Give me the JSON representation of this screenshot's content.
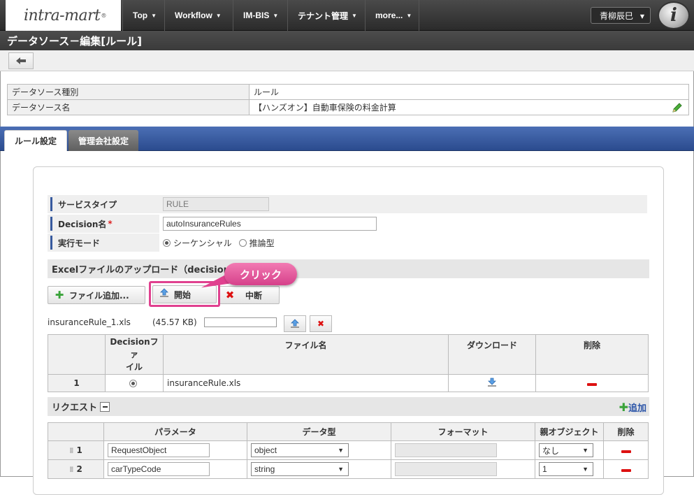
{
  "nav": {
    "logo": "intra-mart",
    "logo_mark": "®",
    "items": [
      "Top",
      "Workflow",
      "IM-BIS",
      "テナント管理",
      "more..."
    ],
    "user": "青柳辰巳"
  },
  "page": {
    "title": "データソース－編集[ルール]"
  },
  "info": {
    "rows": [
      {
        "label": "データソース種別",
        "value": "ルール"
      },
      {
        "label": "データソース名",
        "value": "【ハンズオン】自動車保険の料金計算"
      }
    ]
  },
  "tabs": [
    "ルール設定",
    "管理会社設定"
  ],
  "form": {
    "service_type_label": "サービスタイプ",
    "service_type_value": "RULE",
    "decision_label": "Decision名",
    "required_mark": "*",
    "decision_value": "autoInsuranceRules",
    "mode_label": "実行モード",
    "mode_options": [
      "シーケンシャル",
      "推論型"
    ]
  },
  "upload": {
    "section_title": "Excelファイルのアップロード（decisionファ",
    "add_file_label": "ファイル追加...",
    "start_label": "開始",
    "cancel_label": "中断",
    "callout": "クリック",
    "pending_file": "insuranceRule_1.xls",
    "pending_size": "(45.57 KB)"
  },
  "file_table": {
    "headers": [
      "",
      "Decisionファイル",
      "ファイル名",
      "ダウンロード",
      "削除"
    ],
    "header_decision_line1": "Decisionファ",
    "header_decision_line2": "イル",
    "rows": [
      {
        "no": "1",
        "file": "insuranceRule.xls"
      }
    ]
  },
  "request": {
    "title": "リクエスト",
    "add_label": "追加",
    "headers": [
      "",
      "パラメータ",
      "データ型",
      "フォーマット",
      "親オブジェクト",
      "削除"
    ],
    "rows": [
      {
        "no": "1",
        "param": "RequestObject",
        "type": "object",
        "parent": "なし"
      },
      {
        "no": "2",
        "param": "carTypeCode",
        "type": "string",
        "parent": "1"
      }
    ]
  },
  "colors": {
    "nav_bg": "#2b2b2b",
    "tab_bar": "#2b4b8e",
    "highlight": "#e0418f",
    "add_green": "#3aa33a",
    "delete_red": "#d11111"
  }
}
